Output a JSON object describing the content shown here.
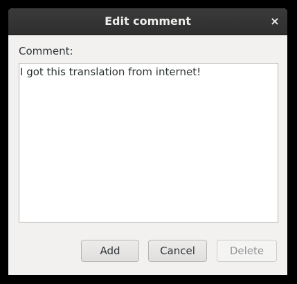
{
  "dialog": {
    "title": "Edit comment",
    "close_glyph": "×"
  },
  "comment": {
    "label": "Comment:",
    "value": "I got this translation from internet!"
  },
  "buttons": {
    "add": "Add",
    "cancel": "Cancel",
    "delete": "Delete"
  },
  "states": {
    "delete_enabled": false
  },
  "icons": {
    "close": "close-icon"
  }
}
